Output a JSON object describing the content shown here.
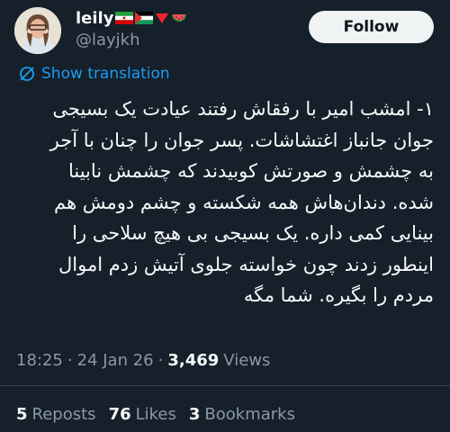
{
  "author": {
    "display_name": "leily",
    "handle": "@layjkh",
    "name_emojis": [
      "flag-iran-icon",
      "flag-palestine-icon",
      "red-triangle-icon",
      "watermelon-icon"
    ]
  },
  "follow_label": "Follow",
  "show_translation_label": "Show translation",
  "tweet": {
    "text": "۱- امشب امیر با رفقاش رفتند عیادت یک بسیجی\nجوان جانباز اغتشاشات. پسر جوان را چنان با آجر\nبه چشمش و صورتش کوبیدند که چشمش نابینا\nشده. دندان‌هاش همه شکسته و چشم دومش هم\nبینایی کمی داره. یک بسیجی بی هیچ سلاحی را\nاینطور زدند چون خواسته جلوی آتیش زدم اموال\nمردم را بگیره. شما مگه"
  },
  "meta": {
    "time": "18:25",
    "date": "24 Jan 26",
    "views_count": "3,469",
    "views_label": "Views"
  },
  "stats": {
    "reposts_count": "5",
    "reposts_label": "Reposts",
    "likes_count": "76",
    "likes_label": "Likes",
    "bookmarks_count": "3",
    "bookmarks_label": "Bookmarks"
  },
  "colors": {
    "background": "#15202b",
    "text": "#f7f9f9",
    "muted": "#8b98a5",
    "accent": "#1d9bf0",
    "button_bg": "#eff3f4"
  }
}
